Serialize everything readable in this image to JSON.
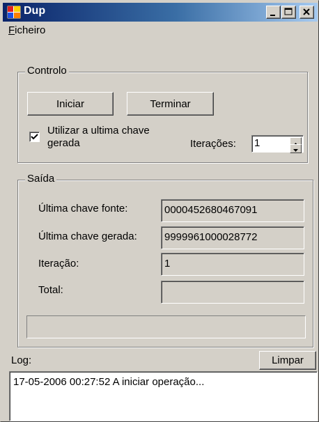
{
  "window": {
    "title": "Dup",
    "colors": {
      "face": "#d4d0c8",
      "title_start": "#0a246a",
      "title_end": "#a6caf0"
    }
  },
  "titlebar_buttons": {
    "minimize_icon": "minimize-icon",
    "maximize_icon": "maximize-icon",
    "close_icon": "close-icon"
  },
  "menu": {
    "items": [
      {
        "label_underlined": "F",
        "label_rest": "icheiro"
      }
    ]
  },
  "controlo": {
    "legend": "Controlo",
    "start_button": "Iniciar",
    "stop_button": "Terminar",
    "checkbox_checked": true,
    "checkbox_label_line1": "Utilizar a ultima chave",
    "checkbox_label_line2": "gerada",
    "iterations_label": "Iterações:",
    "iterations_value": "1"
  },
  "saida": {
    "legend": "Saída",
    "rows": [
      {
        "label": "Última chave fonte:",
        "value": "0000452680467091"
      },
      {
        "label": "Última chave gerada:",
        "value": "9999961000028772"
      },
      {
        "label": "Iteração:",
        "value": "1"
      },
      {
        "label": "Total:",
        "value": ""
      }
    ],
    "progress": 0
  },
  "log": {
    "label": "Log:",
    "clear_button": "Limpar",
    "lines": [
      "17-05-2006 00:27:52  A iniciar operação..."
    ]
  }
}
